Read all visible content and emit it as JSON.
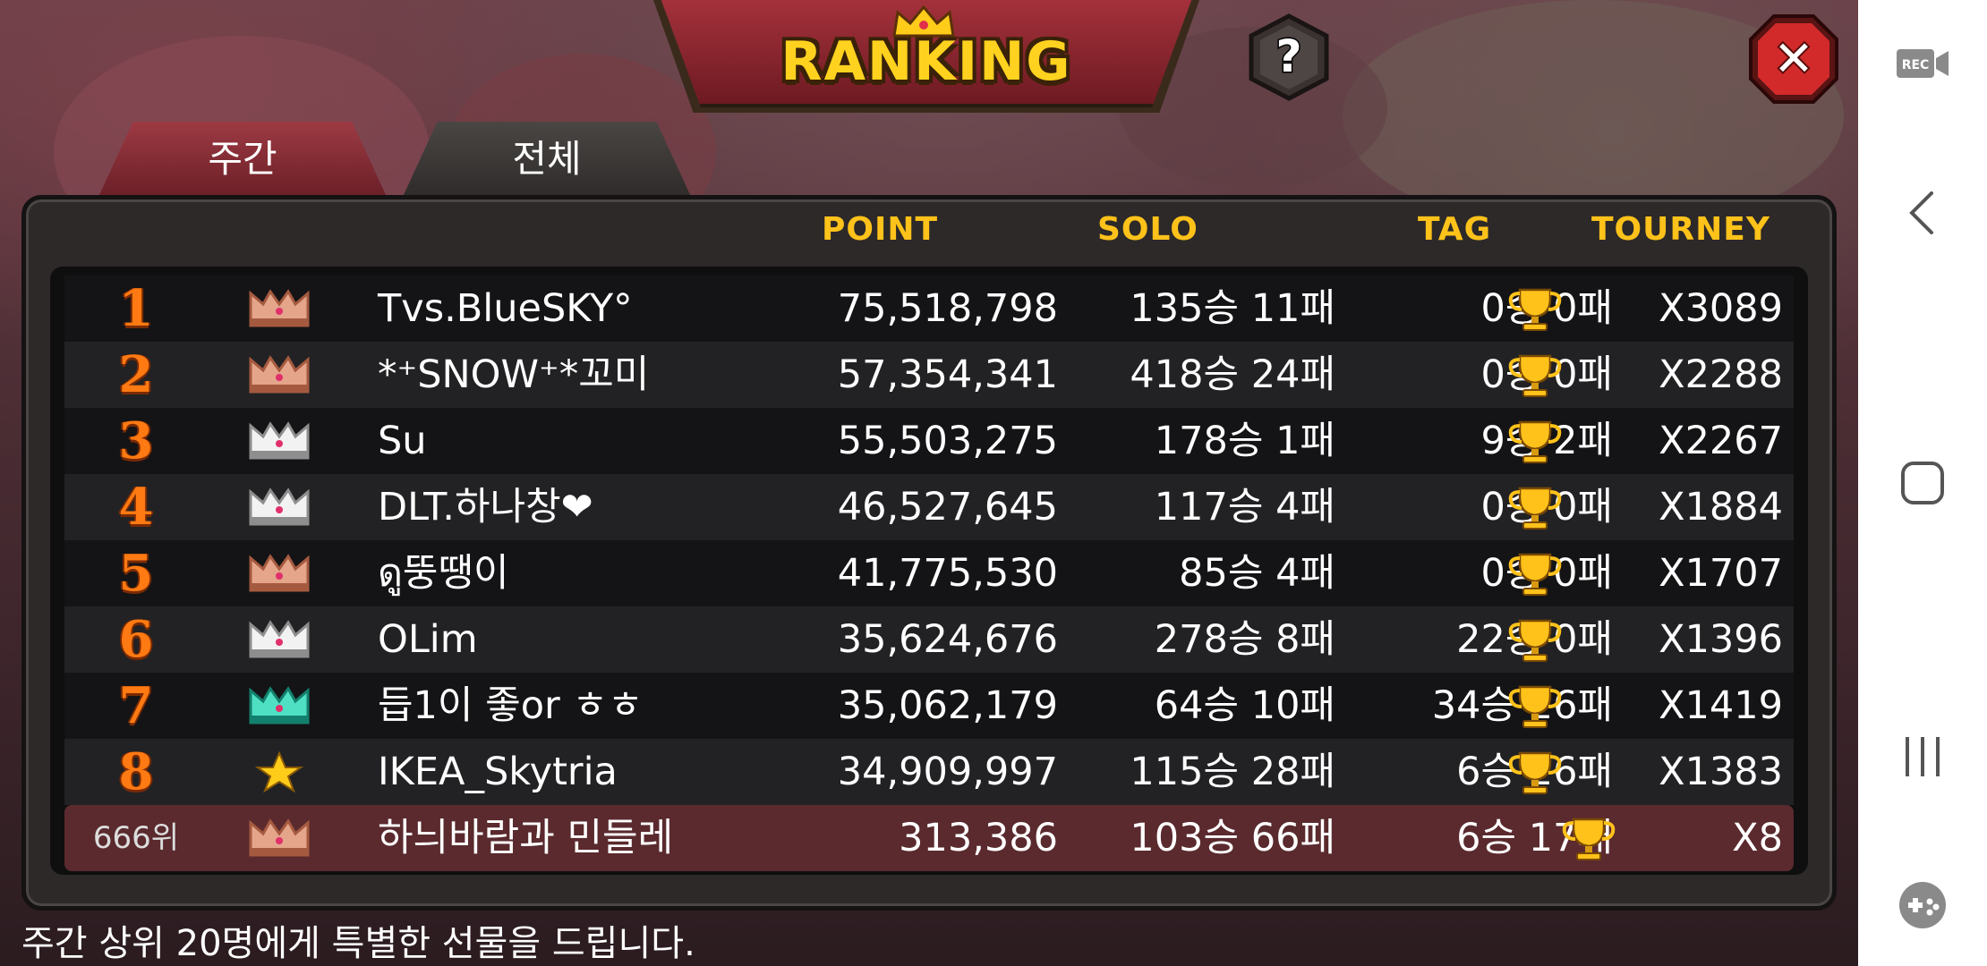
{
  "header": {
    "title": "RANKING"
  },
  "buttons": {
    "help_icon": "?",
    "close_icon": "✕"
  },
  "tabs": [
    {
      "label": "주간",
      "active": true
    },
    {
      "label": "전체",
      "active": false
    }
  ],
  "columns": {
    "point": "POINT",
    "solo": "SOLO",
    "tag": "TAG",
    "tourney": "TOURNEY"
  },
  "rows": [
    {
      "rank": "1",
      "badge": "crown-bronze",
      "name": "Tvs.BlueSKY°",
      "point": "75,518,798",
      "solo": "135승 11패",
      "tag": "0승 0패",
      "tourney": "X3089"
    },
    {
      "rank": "2",
      "badge": "crown-bronze",
      "name": "*⁺SNOW⁺*꼬미",
      "point": "57,354,341",
      "solo": "418승 24패",
      "tag": "0승 0패",
      "tourney": "X2288"
    },
    {
      "rank": "3",
      "badge": "crown-silver",
      "name": "Su",
      "point": "55,503,275",
      "solo": "178승 1패",
      "tag": "9승 2패",
      "tourney": "X2267"
    },
    {
      "rank": "4",
      "badge": "crown-silver",
      "name": "DLT.하나창❤",
      "point": "46,527,645",
      "solo": "117승 4패",
      "tag": "0승 0패",
      "tourney": "X1884"
    },
    {
      "rank": "5",
      "badge": "crown-bronze",
      "name": "ดู뚱땡이",
      "point": "41,775,530",
      "solo": "85승 4패",
      "tag": "0승 0패",
      "tourney": "X1707"
    },
    {
      "rank": "6",
      "badge": "crown-silver",
      "name": "OLim",
      "point": "35,624,676",
      "solo": "278승 8패",
      "tag": "22승 0패",
      "tourney": "X1396"
    },
    {
      "rank": "7",
      "badge": "crown-teal",
      "name": "듭1이 좋or ㅎㅎ",
      "point": "35,062,179",
      "solo": "64승 10패",
      "tag": "34승 26패",
      "tourney": "X1419"
    },
    {
      "rank": "8",
      "badge": "star-gold",
      "name": "IKEA_Skytria",
      "point": "34,909,997",
      "solo": "115승 28패",
      "tag": "6승 26패",
      "tourney": "X1383"
    }
  ],
  "my_row": {
    "rank": "666위",
    "badge": "crown-bronze",
    "name": "하늬바람과 민들레",
    "point": "313,386",
    "solo": "103승 66패",
    "tag": "6승 17패",
    "tourney": "X8"
  },
  "footer_note": "주간 상위 20명에게 특별한 선물을 드립니다.",
  "navbar": {
    "rec_label": "REC"
  },
  "colors": {
    "accent_gold": "#ffc21a",
    "rank_orange": "#ff7a12",
    "my_row_bg": "#5a2a2e"
  }
}
